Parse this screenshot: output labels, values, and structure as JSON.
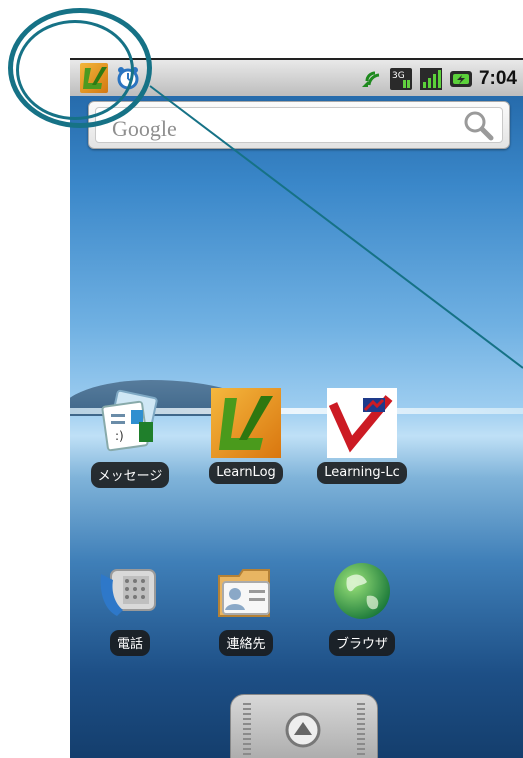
{
  "status_bar": {
    "time": "7:04",
    "icons": [
      "learnlog-notification-icon",
      "alarm-clock-icon",
      "sync-icon",
      "3g-data-icon",
      "signal-bars-icon",
      "battery-charging-icon"
    ]
  },
  "search": {
    "logo": "Google",
    "button_icon": "search-magnifier-icon"
  },
  "apps": [
    {
      "label": "メッセージ",
      "icon": "messaging-icon"
    },
    {
      "label": "LearnLog",
      "icon": "learnlog-app-icon"
    },
    {
      "label": "Learning-Lc",
      "icon": "learning-log-app-icon"
    },
    {
      "label": "電話",
      "icon": "phone-icon"
    },
    {
      "label": "連絡先",
      "icon": "contacts-icon"
    },
    {
      "label": "ブラウザ",
      "icon": "browser-globe-icon"
    }
  ],
  "launcher": {
    "icon": "app-drawer-up-arrow-icon"
  },
  "colors": {
    "annotation": "#167286",
    "learnlog_orange": "#e89a22",
    "learnlog_green": "#3d8c1f",
    "label_background": "#191919"
  }
}
